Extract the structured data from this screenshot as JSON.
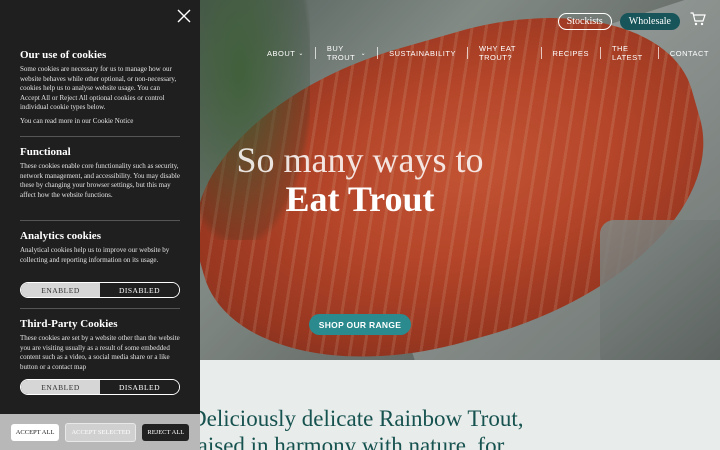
{
  "header": {
    "stockists_label": "Stockists",
    "wholesale_label": "Wholesale",
    "nav": [
      {
        "label": "ABOUT"
      },
      {
        "label": "BUY TROUT"
      },
      {
        "label": "SUSTAINABILITY"
      },
      {
        "label": "WHY EAT TROUT?"
      },
      {
        "label": "RECIPES"
      },
      {
        "label": "THE LATEST"
      },
      {
        "label": "CONTACT"
      }
    ]
  },
  "hero": {
    "line1": "So many ways to",
    "line2": "Eat Trout",
    "cta": "SHOP OUR RANGE"
  },
  "lower": {
    "line1": "Deliciously delicate Rainbow Trout,",
    "line2": "raised in harmony with nature, for"
  },
  "cookies": {
    "use": {
      "title": "Our use of cookies",
      "body": "Some cookies are necessary for us to manage how our website behaves while other optional, or non-necessary, cookies help us to analyse website usage. You can Accept All or Reject All optional cookies or control individual cookie types below.",
      "notice": "You can read more in our Cookie Notice"
    },
    "functional": {
      "title": "Functional",
      "body": "These cookies enable core functionality such as security, network management, and accessibility. You may disable these by changing your browser settings, but this may affect how the website functions."
    },
    "analytics": {
      "title": "Analytics cookies",
      "body": "Analytical cookies help us to improve our website by collecting and reporting information on its usage.",
      "enabled_label": "ENABLED",
      "disabled_label": "DISABLED",
      "state": "disabled"
    },
    "third_party": {
      "title": "Third-Party Cookies",
      "body": "These cookies are set by a website other than the website you are visiting usually as a result of some embedded content such as a video, a social media share or a like button or a contact map",
      "enabled_label": "ENABLED",
      "disabled_label": "DISABLED",
      "state": "disabled"
    },
    "buttons": {
      "accept_all": "ACCEPT ALL",
      "accept_selected": "ACCEPT SELECTED",
      "reject_all": "REJECT ALL"
    }
  },
  "colors": {
    "brand_teal": "#17555a",
    "cta_teal": "#2a8a8e",
    "panel_bg": "#1f1f1f"
  },
  "icons": [
    "close-icon",
    "cart-icon",
    "chevron-down-icon"
  ]
}
